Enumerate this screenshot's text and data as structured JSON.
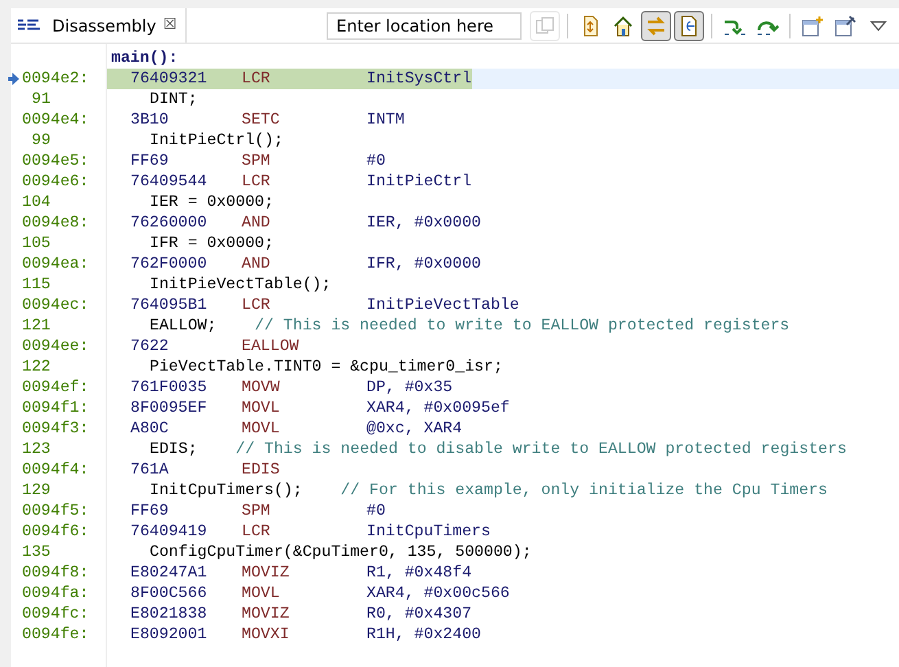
{
  "tab": {
    "title": "Disassembly",
    "close": "☒"
  },
  "location_field": {
    "placeholder": "Enter location here"
  },
  "toolbar": [
    {
      "kind": "goto",
      "pressed": false,
      "disabled": true
    },
    {
      "kind": "sep"
    },
    {
      "kind": "refresh",
      "pressed": false,
      "disabled": false
    },
    {
      "kind": "home",
      "pressed": false,
      "disabled": false
    },
    {
      "kind": "link",
      "pressed": true,
      "disabled": false
    },
    {
      "kind": "source",
      "pressed": true,
      "disabled": false
    },
    {
      "kind": "sep"
    },
    {
      "kind": "stepinto",
      "pressed": false,
      "disabled": false
    },
    {
      "kind": "stepover",
      "pressed": false,
      "disabled": false
    },
    {
      "kind": "sep"
    },
    {
      "kind": "newview",
      "pressed": false,
      "disabled": false
    },
    {
      "kind": "pin",
      "pressed": false,
      "disabled": false
    },
    {
      "kind": "menu",
      "pressed": false,
      "disabled": false
    }
  ],
  "lines": [
    {
      "kind": "label",
      "text": "main():"
    },
    {
      "kind": "instr",
      "address": "0094e2:",
      "opcode": "76409321",
      "mnemonic": "LCR",
      "operand": "InitSysCtrl",
      "current": true
    },
    {
      "kind": "source",
      "line_no": "91",
      "code": "DINT;"
    },
    {
      "kind": "instr",
      "address": "0094e4:",
      "opcode": "3B10",
      "mnemonic": "SETC",
      "operand": "INTM",
      "current": false
    },
    {
      "kind": "source",
      "line_no": "99",
      "code": "InitPieCtrl();"
    },
    {
      "kind": "instr",
      "address": "0094e5:",
      "opcode": "FF69",
      "mnemonic": "SPM",
      "operand": "#0",
      "current": false
    },
    {
      "kind": "instr",
      "address": "0094e6:",
      "opcode": "76409544",
      "mnemonic": "LCR",
      "operand": "InitPieCtrl",
      "current": false
    },
    {
      "kind": "source",
      "line_no": "104",
      "code": "IER = 0x0000;"
    },
    {
      "kind": "instr",
      "address": "0094e8:",
      "opcode": "76260000",
      "mnemonic": "AND",
      "operand": "IER, #0x0000",
      "current": false
    },
    {
      "kind": "source",
      "line_no": "105",
      "code": "IFR = 0x0000;"
    },
    {
      "kind": "instr",
      "address": "0094ea:",
      "opcode": "762F0000",
      "mnemonic": "AND",
      "operand": "IFR, #0x0000",
      "current": false
    },
    {
      "kind": "source",
      "line_no": "115",
      "code": "InitPieVectTable();"
    },
    {
      "kind": "instr",
      "address": "0094ec:",
      "opcode": "764095B1",
      "mnemonic": "LCR",
      "operand": "InitPieVectTable",
      "current": false
    },
    {
      "kind": "source",
      "line_no": "121",
      "code": "EALLOW;",
      "comment": "// This is needed to write to EALLOW protected registers"
    },
    {
      "kind": "instr",
      "address": "0094ee:",
      "opcode": "7622",
      "mnemonic": "EALLOW",
      "current": false
    },
    {
      "kind": "source",
      "line_no": "122",
      "code": "PieVectTable.TINT0 = &cpu_timer0_isr;"
    },
    {
      "kind": "instr",
      "address": "0094ef:",
      "opcode": "761F0035",
      "mnemonic": "MOVW",
      "operand": "DP, #0x35",
      "current": false
    },
    {
      "kind": "instr",
      "address": "0094f1:",
      "opcode": "8F0095EF",
      "mnemonic": "MOVL",
      "operand": "XAR4, #0x0095ef",
      "current": false
    },
    {
      "kind": "instr",
      "address": "0094f3:",
      "opcode": "A80C",
      "mnemonic": "MOVL",
      "operand": "@0xc, XAR4",
      "current": false
    },
    {
      "kind": "source",
      "line_no": "123",
      "code": "EDIS;",
      "comment": "// This is needed to disable write to EALLOW protected registers"
    },
    {
      "kind": "instr",
      "address": "0094f4:",
      "opcode": "761A",
      "mnemonic": "EDIS",
      "current": false
    },
    {
      "kind": "source",
      "line_no": "129",
      "code": "InitCpuTimers();",
      "comment": "// For this example, only initialize the Cpu Timers"
    },
    {
      "kind": "instr",
      "address": "0094f5:",
      "opcode": "FF69",
      "mnemonic": "SPM",
      "operand": "#0",
      "current": false
    },
    {
      "kind": "instr",
      "address": "0094f6:",
      "opcode": "76409419",
      "mnemonic": "LCR",
      "operand": "InitCpuTimers",
      "current": false
    },
    {
      "kind": "source",
      "line_no": "135",
      "code": "ConfigCpuTimer(&CpuTimer0, 135, 500000);"
    },
    {
      "kind": "instr",
      "address": "0094f8:",
      "opcode": "E80247A1",
      "mnemonic": "MOVIZ",
      "operand": "R1, #0x48f4",
      "current": false
    },
    {
      "kind": "instr",
      "address": "0094fa:",
      "opcode": "8F00C566",
      "mnemonic": "MOVL",
      "operand": "XAR4, #0x00c566",
      "current": false
    },
    {
      "kind": "instr",
      "address": "0094fc:",
      "opcode": "E8021838",
      "mnemonic": "MOVIZ",
      "operand": "R0, #0x4307",
      "current": false
    },
    {
      "kind": "instr",
      "address": "0094fe:",
      "opcode": "E8092001",
      "mnemonic": "MOVXI",
      "operand": "R1H, #0x2400",
      "current": false
    }
  ]
}
